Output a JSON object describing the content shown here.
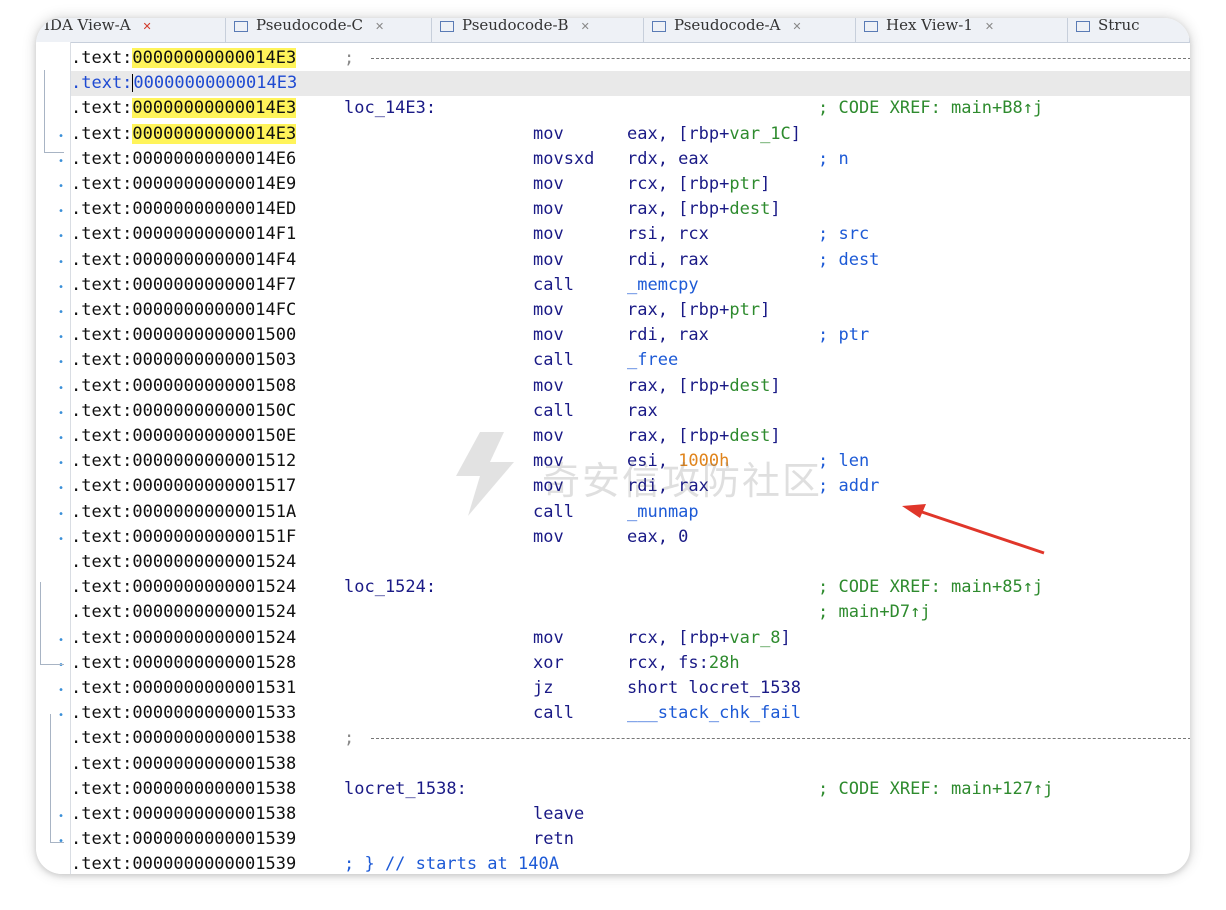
{
  "tabs": [
    {
      "label": "IDA View-A",
      "close": "✕"
    },
    {
      "label": "Pseudocode-C",
      "close": "✕"
    },
    {
      "label": "Pseudocode-B",
      "close": "✕"
    },
    {
      "label": "Pseudocode-A",
      "close": "✕"
    },
    {
      "label": "Hex View-1",
      "close": "✕"
    },
    {
      "label": "Struc",
      "close": ""
    }
  ],
  "watermark": {
    "text": "奇安信攻防社区"
  },
  "rows": [
    {
      "seg": ".text:",
      "addr": "00000000000014E3",
      "highlight": true,
      "sep": ";"
    },
    {
      "seg": ".text:",
      "addr": "00000000000014E3",
      "current": true
    },
    {
      "seg": ".text:",
      "addr": "00000000000014E3",
      "highlight": true,
      "label": "loc_14E3:",
      "comment": "; CODE XREF: main+B8↑j",
      "comment_xref": true
    },
    {
      "seg": ".text:",
      "addr": "00000000000014E3",
      "highlight": true,
      "mnem": "mov",
      "ops": [
        {
          "t": "eax, [rbp+"
        },
        {
          "t": "var_1C",
          "c": "green"
        },
        {
          "t": "]"
        }
      ]
    },
    {
      "seg": ".text:",
      "addr": "00000000000014E6",
      "mnem": "movsxd",
      "ops": [
        {
          "t": "rdx, eax"
        }
      ],
      "comment": "; n"
    },
    {
      "seg": ".text:",
      "addr": "00000000000014E9",
      "mnem": "mov",
      "ops": [
        {
          "t": "rcx, [rbp+"
        },
        {
          "t": "ptr",
          "c": "green"
        },
        {
          "t": "]"
        }
      ]
    },
    {
      "seg": ".text:",
      "addr": "00000000000014ED",
      "mnem": "mov",
      "ops": [
        {
          "t": "rax, [rbp+"
        },
        {
          "t": "dest",
          "c": "green"
        },
        {
          "t": "]"
        }
      ]
    },
    {
      "seg": ".text:",
      "addr": "00000000000014F1",
      "mnem": "mov",
      "ops": [
        {
          "t": "rsi, rcx"
        }
      ],
      "comment": "; src"
    },
    {
      "seg": ".text:",
      "addr": "00000000000014F4",
      "mnem": "mov",
      "ops": [
        {
          "t": "rdi, rax"
        }
      ],
      "comment": "; dest"
    },
    {
      "seg": ".text:",
      "addr": "00000000000014F7",
      "mnem": "call",
      "ops": [
        {
          "t": "_memcpy",
          "c": "blue"
        }
      ]
    },
    {
      "seg": ".text:",
      "addr": "00000000000014FC",
      "mnem": "mov",
      "ops": [
        {
          "t": "rax, [rbp+"
        },
        {
          "t": "ptr",
          "c": "green"
        },
        {
          "t": "]"
        }
      ]
    },
    {
      "seg": ".text:",
      "addr": "0000000000001500",
      "mnem": "mov",
      "ops": [
        {
          "t": "rdi, rax"
        }
      ],
      "comment": "; ptr"
    },
    {
      "seg": ".text:",
      "addr": "0000000000001503",
      "mnem": "call",
      "ops": [
        {
          "t": "_free",
          "c": "blue"
        }
      ]
    },
    {
      "seg": ".text:",
      "addr": "0000000000001508",
      "mnem": "mov",
      "ops": [
        {
          "t": "rax, [rbp+"
        },
        {
          "t": "dest",
          "c": "green"
        },
        {
          "t": "]"
        }
      ]
    },
    {
      "seg": ".text:",
      "addr": "000000000000150C",
      "mnem": "call",
      "ops": [
        {
          "t": "rax"
        }
      ]
    },
    {
      "seg": ".text:",
      "addr": "000000000000150E",
      "mnem": "mov",
      "ops": [
        {
          "t": "rax, [rbp+"
        },
        {
          "t": "dest",
          "c": "green"
        },
        {
          "t": "]"
        }
      ]
    },
    {
      "seg": ".text:",
      "addr": "0000000000001512",
      "mnem": "mov",
      "ops": [
        {
          "t": "esi, "
        },
        {
          "t": "1000h",
          "c": "orange"
        }
      ],
      "comment": "; len"
    },
    {
      "seg": ".text:",
      "addr": "0000000000001517",
      "mnem": "mov",
      "ops": [
        {
          "t": "rdi, rax"
        }
      ],
      "comment": "; addr"
    },
    {
      "seg": ".text:",
      "addr": "000000000000151A",
      "mnem": "call",
      "ops": [
        {
          "t": "_munmap",
          "c": "blue"
        }
      ]
    },
    {
      "seg": ".text:",
      "addr": "000000000000151F",
      "mnem": "mov",
      "ops": [
        {
          "t": "eax, 0"
        }
      ]
    },
    {
      "seg": ".text:",
      "addr": "0000000000001524"
    },
    {
      "seg": ".text:",
      "addr": "0000000000001524",
      "label": "loc_1524:",
      "comment": "; CODE XREF: main+85↑j",
      "comment_xref": true
    },
    {
      "seg": ".text:",
      "addr": "0000000000001524",
      "comment": "; main+D7↑j",
      "comment_xref": true
    },
    {
      "seg": ".text:",
      "addr": "0000000000001524",
      "mnem": "mov",
      "ops": [
        {
          "t": "rcx, [rbp+"
        },
        {
          "t": "var_8",
          "c": "green"
        },
        {
          "t": "]"
        }
      ]
    },
    {
      "seg": ".text:",
      "addr": "0000000000001528",
      "mnem": "xor",
      "ops": [
        {
          "t": "rcx, fs:"
        },
        {
          "t": "28h",
          "c": "green"
        }
      ]
    },
    {
      "seg": ".text:",
      "addr": "0000000000001531",
      "mnem": "jz",
      "ops": [
        {
          "t": "short locret_1538"
        }
      ]
    },
    {
      "seg": ".text:",
      "addr": "0000000000001533",
      "mnem": "call",
      "ops": [
        {
          "t": "___stack_chk_fail",
          "c": "blue"
        }
      ]
    },
    {
      "seg": ".text:",
      "addr": "0000000000001538",
      "sep": ";"
    },
    {
      "seg": ".text:",
      "addr": "0000000000001538"
    },
    {
      "seg": ".text:",
      "addr": "0000000000001538",
      "label": "locret_1538:",
      "comment": "; CODE XREF: main+127↑j",
      "comment_xref": true
    },
    {
      "seg": ".text:",
      "addr": "0000000000001538",
      "mnem": "leave"
    },
    {
      "seg": ".text:",
      "addr": "0000000000001539",
      "mnem": "retn"
    },
    {
      "seg": ".text:",
      "addr": "0000000000001539",
      "label": "; } // starts at 140A",
      "label_blue": true
    }
  ]
}
